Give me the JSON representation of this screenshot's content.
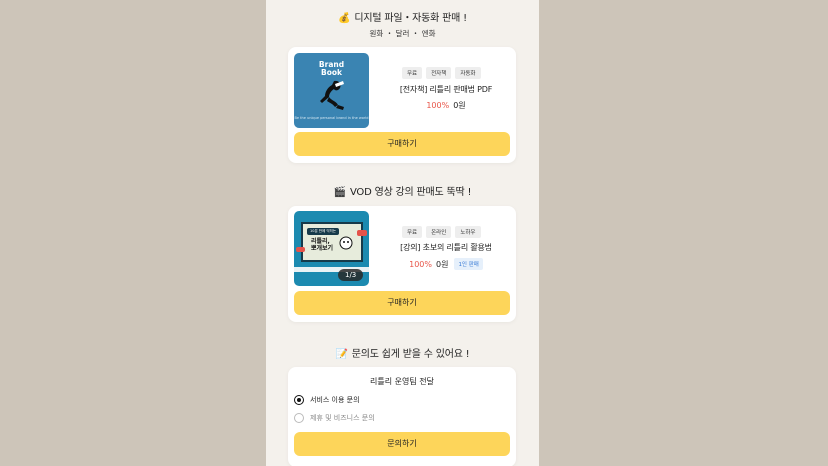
{
  "colors": {
    "background": "#cdc5b9",
    "panel": "#f4f1ec",
    "button": "#fdd55a",
    "discount": "#e8564a",
    "badge_text": "#3a7bd5"
  },
  "section_file": {
    "icon": "money-bag-icon",
    "emoji": "💰",
    "title": "디지털 파일・자동화 판매 !",
    "currencies": "원화 ・ 달러 ・ 엔화"
  },
  "product_ebook": {
    "thumb_title_line1": "Brand",
    "thumb_title_line2": "Book",
    "thumb_footer": "Be the unique personal brand in the world",
    "tags": [
      "무료",
      "전자책",
      "자동화"
    ],
    "name": "[전자책] 리틀리 판매법 PDF",
    "discount": "100%",
    "price": "0원",
    "button": "구매하기"
  },
  "section_vod": {
    "icon": "clapperboard-icon",
    "emoji": "🎬",
    "title": "VOD 영상 강의 판매도 뚝딱 !"
  },
  "product_vod": {
    "thumb_tag": "10분 만에 익히는",
    "thumb_line1": "리틀리,",
    "thumb_line2": "뽀개보기",
    "pager": "1/3",
    "tags": [
      "무료",
      "온라인",
      "노하우"
    ],
    "name": "[강의] 초보의 리틀리 활용법",
    "discount": "100%",
    "price": "0원",
    "badge": "1인 판매",
    "button": "구매하기"
  },
  "section_inquiry": {
    "icon": "memo-icon",
    "emoji": "📝",
    "title": "문의도 쉽게 받을 수 있어요 !"
  },
  "inquiry_form": {
    "title": "리틀리 운영팀 전달",
    "options": [
      "서비스 이용 문의",
      "제휴 및 비즈니스 문의"
    ],
    "selected": "서비스 이용 문의",
    "button": "문의하기"
  }
}
